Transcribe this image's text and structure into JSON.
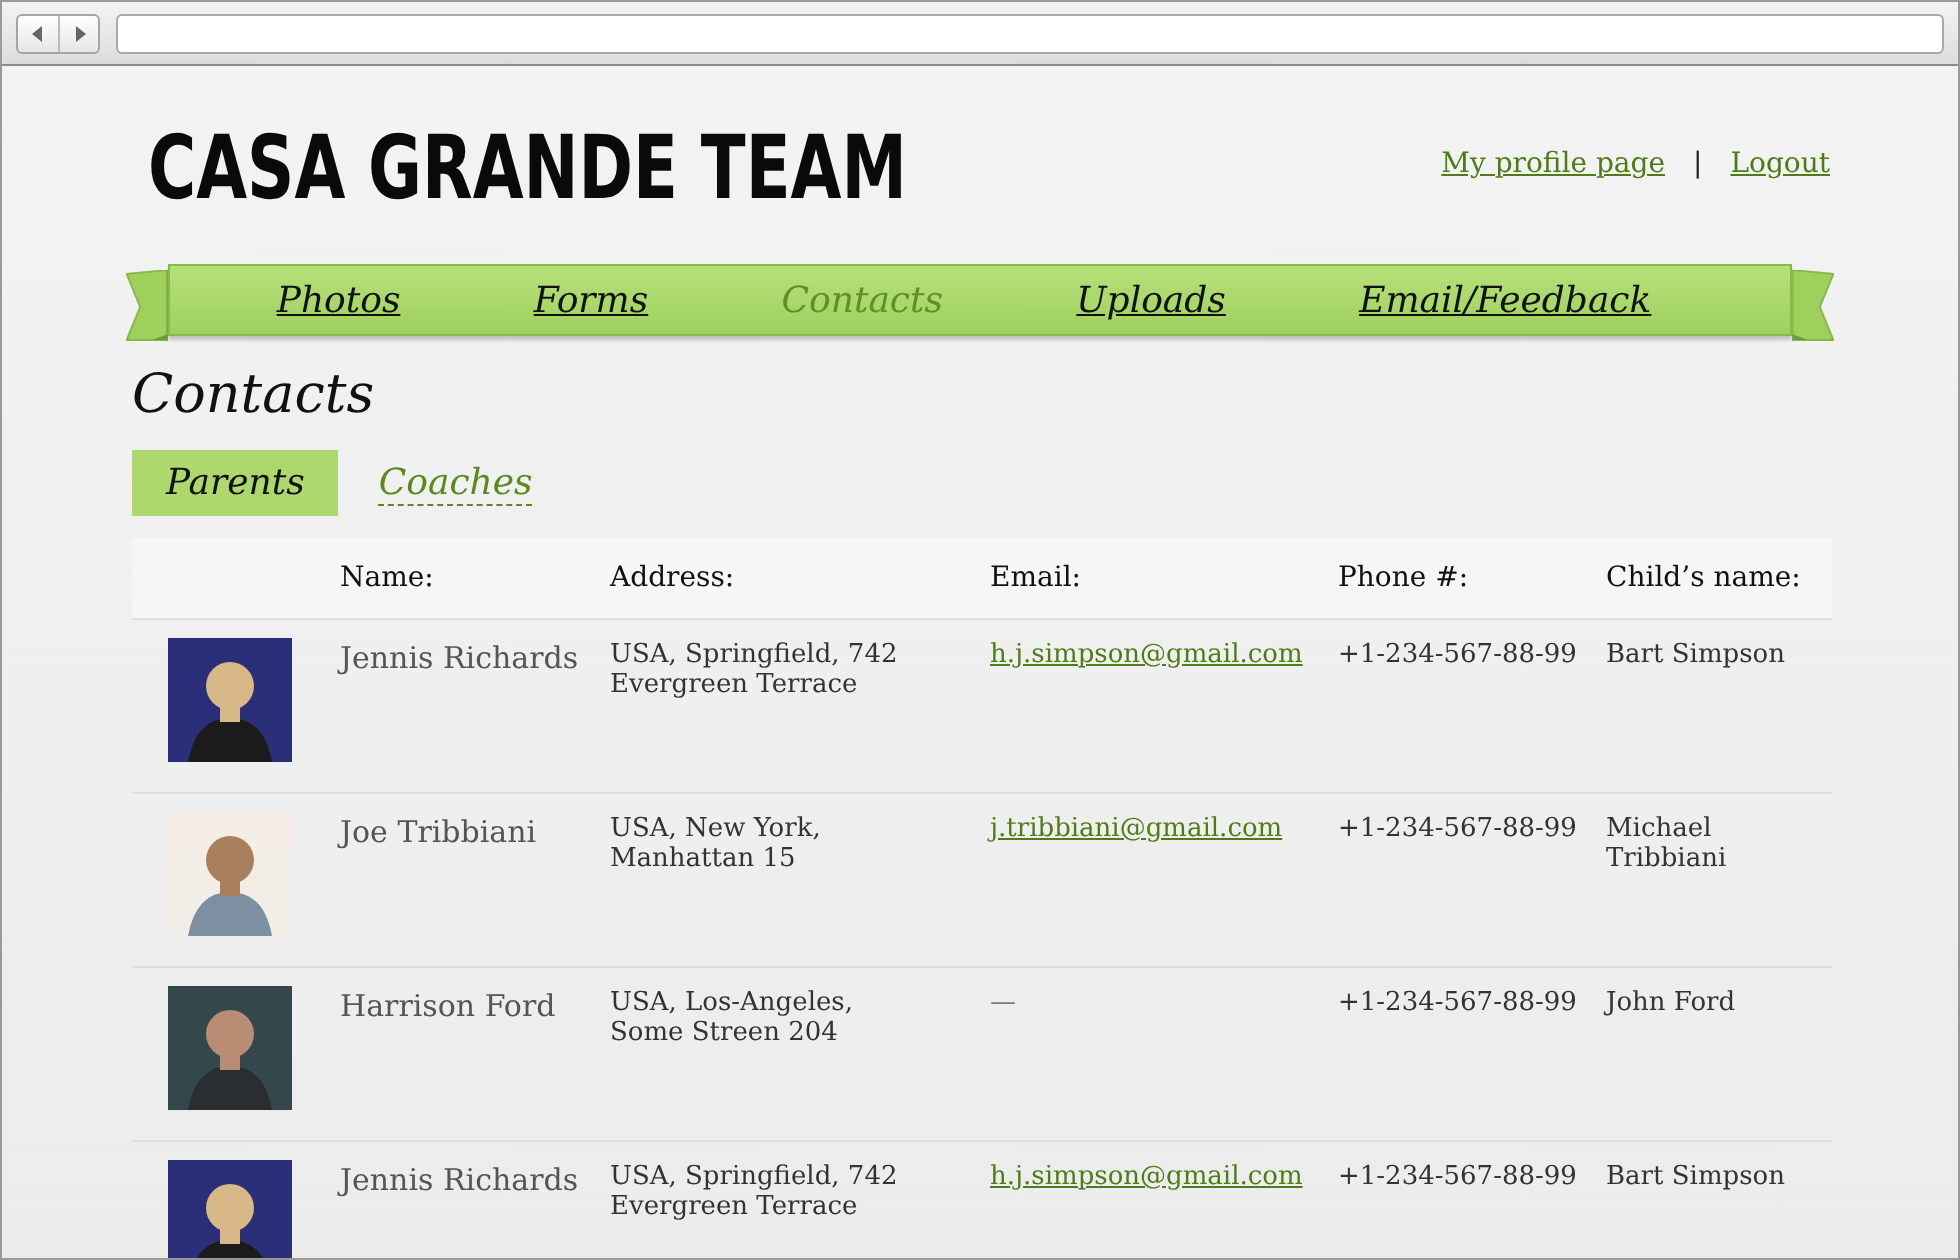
{
  "site": {
    "logo": "CASA GRANDE TEAM",
    "links": [
      {
        "label": "My profile page"
      },
      {
        "label": "Logout"
      }
    ],
    "separator": "|"
  },
  "nav": [
    {
      "label": "Photos",
      "selected": false
    },
    {
      "label": "Forms",
      "selected": false
    },
    {
      "label": "Contacts",
      "selected": true
    },
    {
      "label": "Uploads",
      "selected": false
    },
    {
      "label": "Email/Feedback",
      "selected": false
    }
  ],
  "page_title": "Contacts",
  "tabs": [
    {
      "label": "Parents",
      "selected": true
    },
    {
      "label": "Coaches",
      "selected": false
    }
  ],
  "table": {
    "columns": [
      "Name:",
      "Address:",
      "Email:",
      "Phone #:",
      "Child’s name:"
    ],
    "rows": [
      {
        "name": "Jennis Richards",
        "address": "USA, Springfield, 742 Evergreen Terrace",
        "email": "h.j.simpson@gmail.com",
        "email_link": true,
        "phone": "+1-234-567-88-99",
        "child": "Bart Simpson"
      },
      {
        "name": "Joe Tribbiani",
        "address": "USA, New York, Manhattan 15",
        "email": "j.tribbiani@gmail.com",
        "email_link": true,
        "phone": "+1-234-567-88-99",
        "child": "Michael Tribbiani"
      },
      {
        "name": "Harrison Ford",
        "address": "USA, Los-Angeles, Some Streen 204",
        "email": "—",
        "email_link": false,
        "phone": "+1-234-567-88-99",
        "child": "John Ford"
      },
      {
        "name": "Jennis Richards",
        "address": "USA, Springfield, 742 Evergreen Terrace",
        "email": "h.j.simpson@gmail.com",
        "email_link": true,
        "phone": "+1-234-567-88-99",
        "child": "Bart Simpson"
      }
    ]
  }
}
